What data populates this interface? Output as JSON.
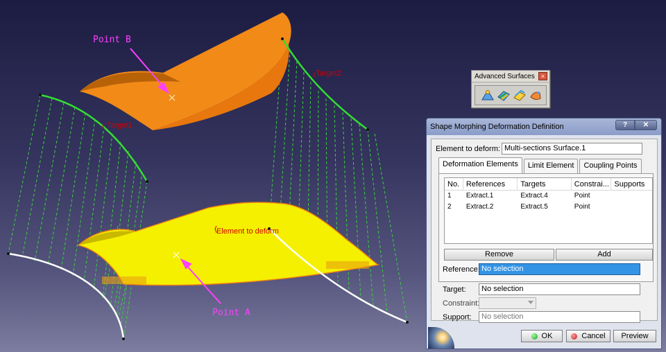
{
  "viewport": {
    "point_b_label": "Point B",
    "point_a_label": "Point A",
    "target2_label": "Target2",
    "target1_label": "Target1",
    "element_label": "Element to deform",
    "colors": {
      "upper_surface": "#f08a1a",
      "lower_surface": "#f4f000",
      "curve_green": "#33dd33",
      "curve_white": "#ffffff",
      "annotation": "#ff40ff"
    }
  },
  "toolbar": {
    "title": "Advanced Surfaces",
    "close_glyph": "×",
    "icons": [
      "bump-icon",
      "wrap-curve-icon",
      "wrap-surface-icon",
      "shape-morphing-icon"
    ]
  },
  "dialog": {
    "title": "Shape Morphing Deformation Definition",
    "help_glyph": "?",
    "close_glyph": "✕",
    "element_label": "Element to deform:",
    "element_value": "Multi-sections Surface.1",
    "tabs": [
      "Deformation Elements",
      "Limit Element",
      "Coupling Points"
    ],
    "table": {
      "headers": [
        "No.",
        "References",
        "Targets",
        "Constrai...",
        "Supports"
      ],
      "rows": [
        [
          "1",
          "Extract.1",
          "Extract.4",
          "Point",
          ""
        ],
        [
          "2",
          "Extract.2",
          "Extract.5",
          "Point",
          ""
        ]
      ]
    },
    "remove_label": "Remove",
    "add_label": "Add",
    "reference_label": "Reference:",
    "reference_value": "No selection",
    "target_label": "Target:",
    "target_value": "No selection",
    "constraint_label": "Constraint:",
    "support_label": "Support:",
    "support_value": "No selection",
    "ok_label": "OK",
    "cancel_label": "Cancel",
    "preview_label": "Preview"
  }
}
